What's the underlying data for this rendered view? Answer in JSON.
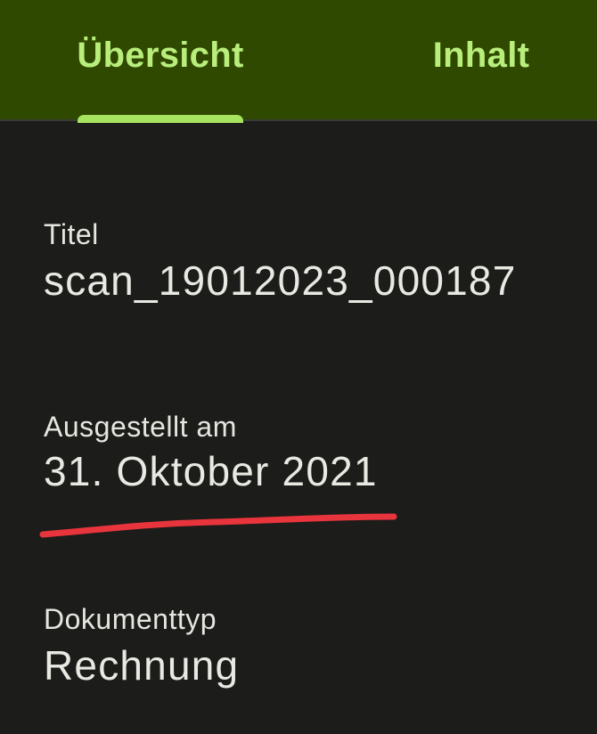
{
  "tabs": [
    {
      "label": "Übersicht",
      "selected": true
    },
    {
      "label": "Inhalt",
      "selected": false
    }
  ],
  "fields": {
    "title": {
      "label": "Titel",
      "value": "scan_19012023_000187"
    },
    "issued": {
      "label": "Ausgestellt am",
      "value": "31. Oktober 2021"
    },
    "doctype": {
      "label": "Dokumenttyp",
      "value": "Rechnung"
    }
  },
  "colors": {
    "tabbar_background": "#2f4a00",
    "tab_text": "#b9ee7d",
    "tab_indicator": "#a6e45f",
    "page_background": "#1c1c1a",
    "text": "#e9e9e3",
    "annotation_underline": "#e8343c"
  }
}
